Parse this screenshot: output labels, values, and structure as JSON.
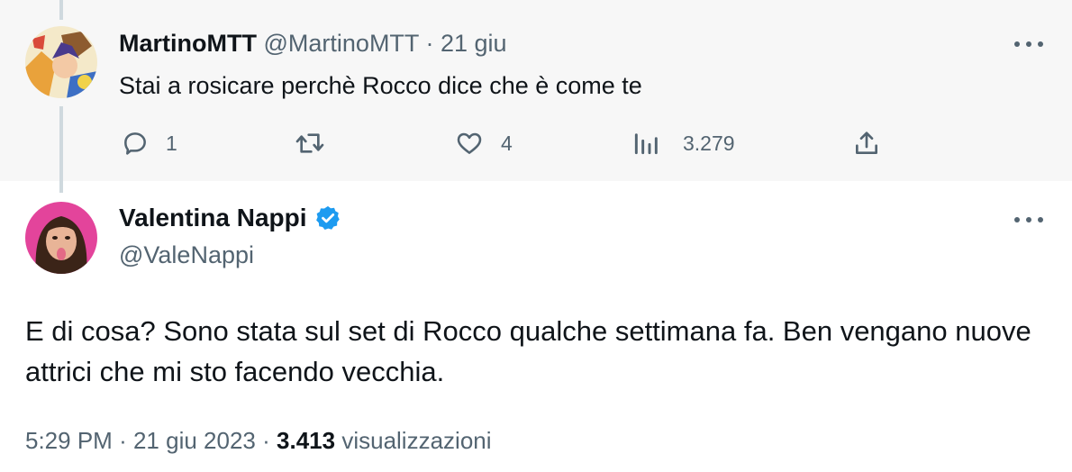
{
  "reply": {
    "display_name": "MartinoMTT",
    "handle": "@MartinoMTT",
    "separator": "·",
    "date": "21 giu",
    "text": "Stai a rosicare perchè Rocco dice che è come te",
    "actions": {
      "replies": "1",
      "retweets": "",
      "likes": "4",
      "views": "3.279"
    }
  },
  "tweet": {
    "display_name": "Valentina Nappi",
    "verified": true,
    "handle": "@ValeNappi",
    "text": "E di cosa? Sono stata sul set di Rocco qualche settimana fa. Ben vengano nuove attrici che mi sto facendo vecchia.",
    "time": "5:29 PM",
    "separator": "·",
    "date": "21 giu 2023",
    "views_count": "3.413",
    "views_label": "visualizzazioni"
  },
  "colors": {
    "accent": "#1d9bf0",
    "muted": "#536471",
    "text": "#0f1419",
    "reply_bg": "#f7f7f7",
    "thread_line": "#cfd9de"
  },
  "icons": [
    "reply-icon",
    "retweet-icon",
    "like-icon",
    "views-icon",
    "share-icon",
    "more-icon",
    "verified-badge-icon"
  ]
}
